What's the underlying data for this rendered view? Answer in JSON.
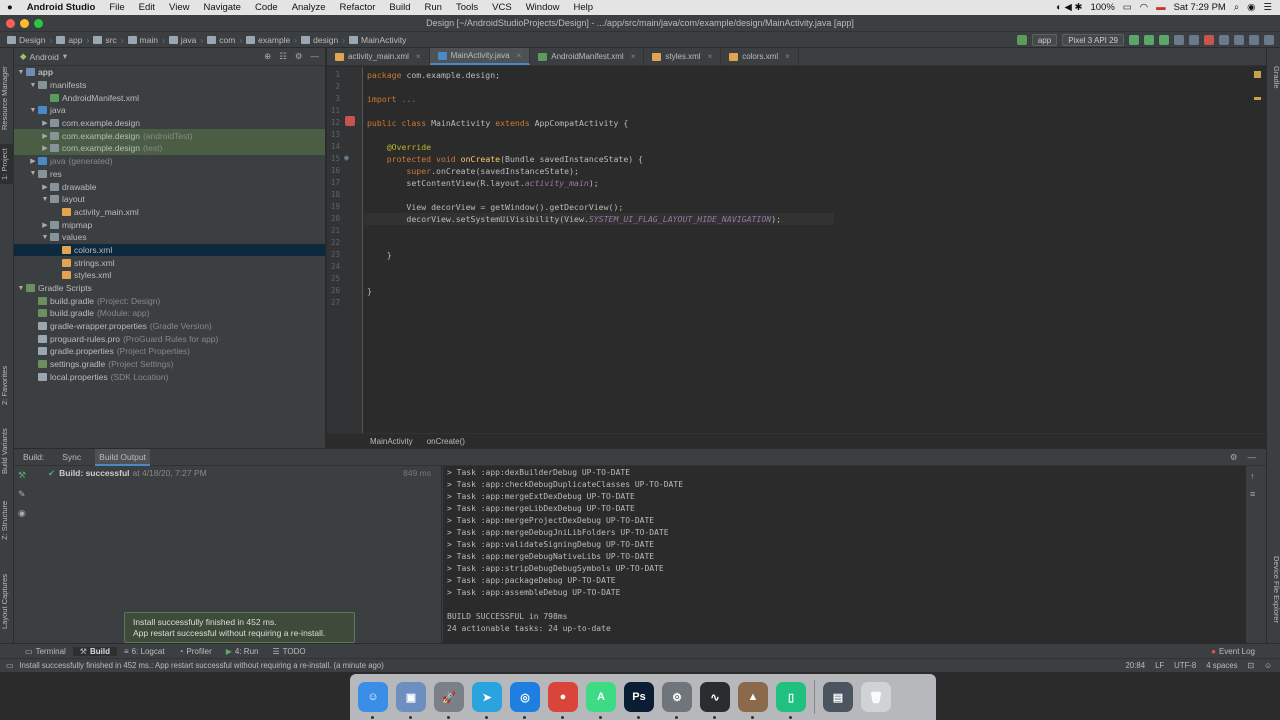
{
  "menubar": {
    "app": "Android Studio",
    "items": [
      "File",
      "Edit",
      "View",
      "Navigate",
      "Code",
      "Analyze",
      "Refactor",
      "Build",
      "Run",
      "Tools",
      "VCS",
      "Window",
      "Help"
    ],
    "battery": "100%",
    "flag": "▬",
    "clock": "Sat 7:29 PM"
  },
  "window": {
    "title": "Design [~/AndroidStudioProjects/Design] - .../app/src/main/java/com/example/design/MainActivity.java [app]"
  },
  "navbar": {
    "crumbs": [
      "Design",
      "app",
      "src",
      "main",
      "java",
      "com",
      "example",
      "design",
      "MainActivity"
    ],
    "run_config": "app",
    "device": "Pixel 3 API 29"
  },
  "left_tabs": {
    "resource_manager": "Resource Manager",
    "project": "1: Project",
    "favorites": "2: Favorites",
    "build_variants": "Build Variants",
    "structure": "Z: Structure",
    "layout_captures": "Layout Captures"
  },
  "right_tabs": {
    "gradle": "Gradle",
    "device_file_explorer": "Device File Explorer"
  },
  "project": {
    "view": "Android",
    "tree": [
      {
        "label": "app",
        "depth": 0,
        "arrow": "▼",
        "icon": "#6e8fb0",
        "bold": true
      },
      {
        "label": "manifests",
        "depth": 1,
        "arrow": "▼",
        "icon": "#87939a"
      },
      {
        "label": "AndroidManifest.xml",
        "depth": 2,
        "arrow": "",
        "icon": "#5b9b5b"
      },
      {
        "label": "java",
        "depth": 1,
        "arrow": "▼",
        "icon": "#4a88c7"
      },
      {
        "label": "com.example.design",
        "depth": 2,
        "arrow": "▶",
        "icon": "#87939a"
      },
      {
        "label": "com.example.design",
        "suffix": "(androidTest)",
        "depth": 2,
        "arrow": "▶",
        "icon": "#87939a",
        "hl": true
      },
      {
        "label": "com.example.design",
        "suffix": "(test)",
        "depth": 2,
        "arrow": "▶",
        "icon": "#87939a",
        "hl": true
      },
      {
        "label": "java",
        "suffix": "(generated)",
        "depth": 1,
        "arrow": "▶",
        "icon": "#4a88c7",
        "dim": true
      },
      {
        "label": "res",
        "depth": 1,
        "arrow": "▼",
        "icon": "#87939a"
      },
      {
        "label": "drawable",
        "depth": 2,
        "arrow": "▶",
        "icon": "#87939a"
      },
      {
        "label": "layout",
        "depth": 2,
        "arrow": "▼",
        "icon": "#87939a"
      },
      {
        "label": "activity_main.xml",
        "depth": 3,
        "arrow": "",
        "icon": "#e2a450"
      },
      {
        "label": "mipmap",
        "depth": 2,
        "arrow": "▶",
        "icon": "#87939a"
      },
      {
        "label": "values",
        "depth": 2,
        "arrow": "▼",
        "icon": "#87939a"
      },
      {
        "label": "colors.xml",
        "depth": 3,
        "arrow": "",
        "icon": "#e2a450",
        "sel": true
      },
      {
        "label": "strings.xml",
        "depth": 3,
        "arrow": "",
        "icon": "#e2a450"
      },
      {
        "label": "styles.xml",
        "depth": 3,
        "arrow": "",
        "icon": "#e2a450"
      },
      {
        "label": "Gradle Scripts",
        "depth": 0,
        "arrow": "▼",
        "icon": "#6c8f5e"
      },
      {
        "label": "build.gradle",
        "suffix": "(Project: Design)",
        "depth": 1,
        "arrow": "",
        "icon": "#6c8f5e"
      },
      {
        "label": "build.gradle",
        "suffix": "(Module: app)",
        "depth": 1,
        "arrow": "",
        "icon": "#6c8f5e"
      },
      {
        "label": "gradle-wrapper.properties",
        "suffix": "(Gradle Version)",
        "depth": 1,
        "arrow": "",
        "icon": "#9aa7b0"
      },
      {
        "label": "proguard-rules.pro",
        "suffix": "(ProGuard Rules for app)",
        "depth": 1,
        "arrow": "",
        "icon": "#9aa7b0"
      },
      {
        "label": "gradle.properties",
        "suffix": "(Project Properties)",
        "depth": 1,
        "arrow": "",
        "icon": "#9aa7b0"
      },
      {
        "label": "settings.gradle",
        "suffix": "(Project Settings)",
        "depth": 1,
        "arrow": "",
        "icon": "#6c8f5e"
      },
      {
        "label": "local.properties",
        "suffix": "(SDK Location)",
        "depth": 1,
        "arrow": "",
        "icon": "#9aa7b0"
      }
    ]
  },
  "tabs": [
    {
      "label": "activity_main.xml",
      "icon": "#e2a450"
    },
    {
      "label": "MainActivity.java",
      "icon": "#4a88c7",
      "active": true
    },
    {
      "label": "AndroidManifest.xml",
      "icon": "#5b9b5b"
    },
    {
      "label": "styles.xml",
      "icon": "#e2a450"
    },
    {
      "label": "colors.xml",
      "icon": "#e2a450"
    }
  ],
  "code": {
    "line_numbers": [
      "1",
      "2",
      "3",
      "11",
      "12",
      "13",
      "14",
      "15",
      "16",
      "17",
      "18",
      "19",
      "20",
      "21",
      "22",
      "23",
      "24",
      "25",
      "26",
      "27"
    ],
    "lines": [
      [
        [
          "kw",
          "package "
        ],
        [
          "",
          "com.example.design;"
        ]
      ],
      [],
      [
        [
          "kw",
          "import "
        ],
        [
          "gr",
          "..."
        ]
      ],
      [],
      [
        [
          "kw",
          "public class "
        ],
        [
          "",
          "MainActivity "
        ],
        [
          "kw",
          "extends "
        ],
        [
          "",
          "AppCompatActivity {"
        ]
      ],
      [],
      [
        [
          "an",
          "    @Override"
        ]
      ],
      [
        [
          "kw",
          "    protected void "
        ],
        [
          "fn",
          "onCreate"
        ],
        [
          "",
          "(Bundle savedInstanceState) {"
        ]
      ],
      [
        [
          "kw",
          "        super"
        ],
        [
          "",
          ".onCreate(savedInstanceState);"
        ]
      ],
      [
        [
          "",
          "        setContentView(R.layout."
        ],
        [
          "it",
          "activity_main"
        ],
        [
          "",
          ");"
        ]
      ],
      [],
      [
        [
          "",
          "        View decorView = getWindow().getDecorView();"
        ]
      ],
      [
        [
          "",
          "        decorView.setSystemUiVisibility(View."
        ],
        [
          "it",
          "SYSTEM_UI_FLAG_LAYOUT_HIDE_NAVIGATION"
        ],
        [
          "",
          ");"
        ]
      ],
      [],
      [],
      [
        [
          "",
          "    }"
        ]
      ],
      [],
      [],
      [
        [
          "",
          "}"
        ]
      ],
      []
    ]
  },
  "editor_breadcrumb": {
    "class": "MainActivity",
    "method": "onCreate()"
  },
  "build": {
    "tabs": [
      "Build:",
      "Sync",
      "Build Output"
    ],
    "status": "Build: successful",
    "status_time": "at 4/18/20, 7:27 PM",
    "duration": "849 ms",
    "output": [
      "> Task :app:dexBuilderDebug UP-TO-DATE",
      "> Task :app:checkDebugDuplicateClasses UP-TO-DATE",
      "> Task :app:mergeExtDexDebug UP-TO-DATE",
      "> Task :app:mergeLibDexDebug UP-TO-DATE",
      "> Task :app:mergeProjectDexDebug UP-TO-DATE",
      "> Task :app:mergeDebugJniLibFolders UP-TO-DATE",
      "> Task :app:validateSigningDebug UP-TO-DATE",
      "> Task :app:mergeDebugNativeLibs UP-TO-DATE",
      "> Task :app:stripDebugDebugSymbols UP-TO-DATE",
      "> Task :app:packageDebug UP-TO-DATE",
      "> Task :app:assembleDebug UP-TO-DATE",
      "",
      "BUILD SUCCESSFUL in 798ms",
      "24 actionable tasks: 24 up-to-date"
    ]
  },
  "toast": {
    "line1": "Install successfully finished in 452 ms.",
    "line2": "App restart successful without requiring a re-install."
  },
  "bottom_tools": {
    "terminal": "Terminal",
    "build": "Build",
    "logcat": "6: Logcat",
    "profiler": "Profiler",
    "run": "4: Run",
    "todo": "TODO",
    "event_log": "Event Log"
  },
  "statusbar": {
    "message": "Install successfully finished in 452 ms.: App restart successful without requiring a re-install. (a minute ago)",
    "position": "20:84",
    "line_sep": "LF",
    "encoding": "UTF-8",
    "indent": "4 spaces"
  },
  "dock": [
    {
      "name": "finder-icon",
      "color": "#3b8ee8",
      "glyph": "☺"
    },
    {
      "name": "preview-icon",
      "color": "#6c8fbf",
      "glyph": "▣"
    },
    {
      "name": "launchpad-icon",
      "color": "#7a7f88",
      "glyph": "🚀"
    },
    {
      "name": "telegram-icon",
      "color": "#2aa3df",
      "glyph": "➤"
    },
    {
      "name": "safari-icon",
      "color": "#1f7fe0",
      "glyph": "◎"
    },
    {
      "name": "chrome-icon",
      "color": "#d9453a",
      "glyph": "●"
    },
    {
      "name": "android-studio-icon",
      "color": "#3ddc84",
      "glyph": "A"
    },
    {
      "name": "photoshop-icon",
      "color": "#0b1d33",
      "glyph": "Ps"
    },
    {
      "name": "system-preferences-icon",
      "color": "#70757c",
      "glyph": "⚙"
    },
    {
      "name": "activity-monitor-icon",
      "color": "#2a2d30",
      "glyph": "∿"
    },
    {
      "name": "android-file-transfer-icon",
      "color": "#8a6a4a",
      "glyph": "▲"
    },
    {
      "name": "android-emulator-icon",
      "color": "#20c080",
      "glyph": "▯"
    },
    {
      "name": "downloads-stack-icon",
      "color": "#4a5560",
      "glyph": "▤"
    },
    {
      "name": "trash-icon",
      "color": "#d0d3d6",
      "glyph": "🗑"
    }
  ]
}
